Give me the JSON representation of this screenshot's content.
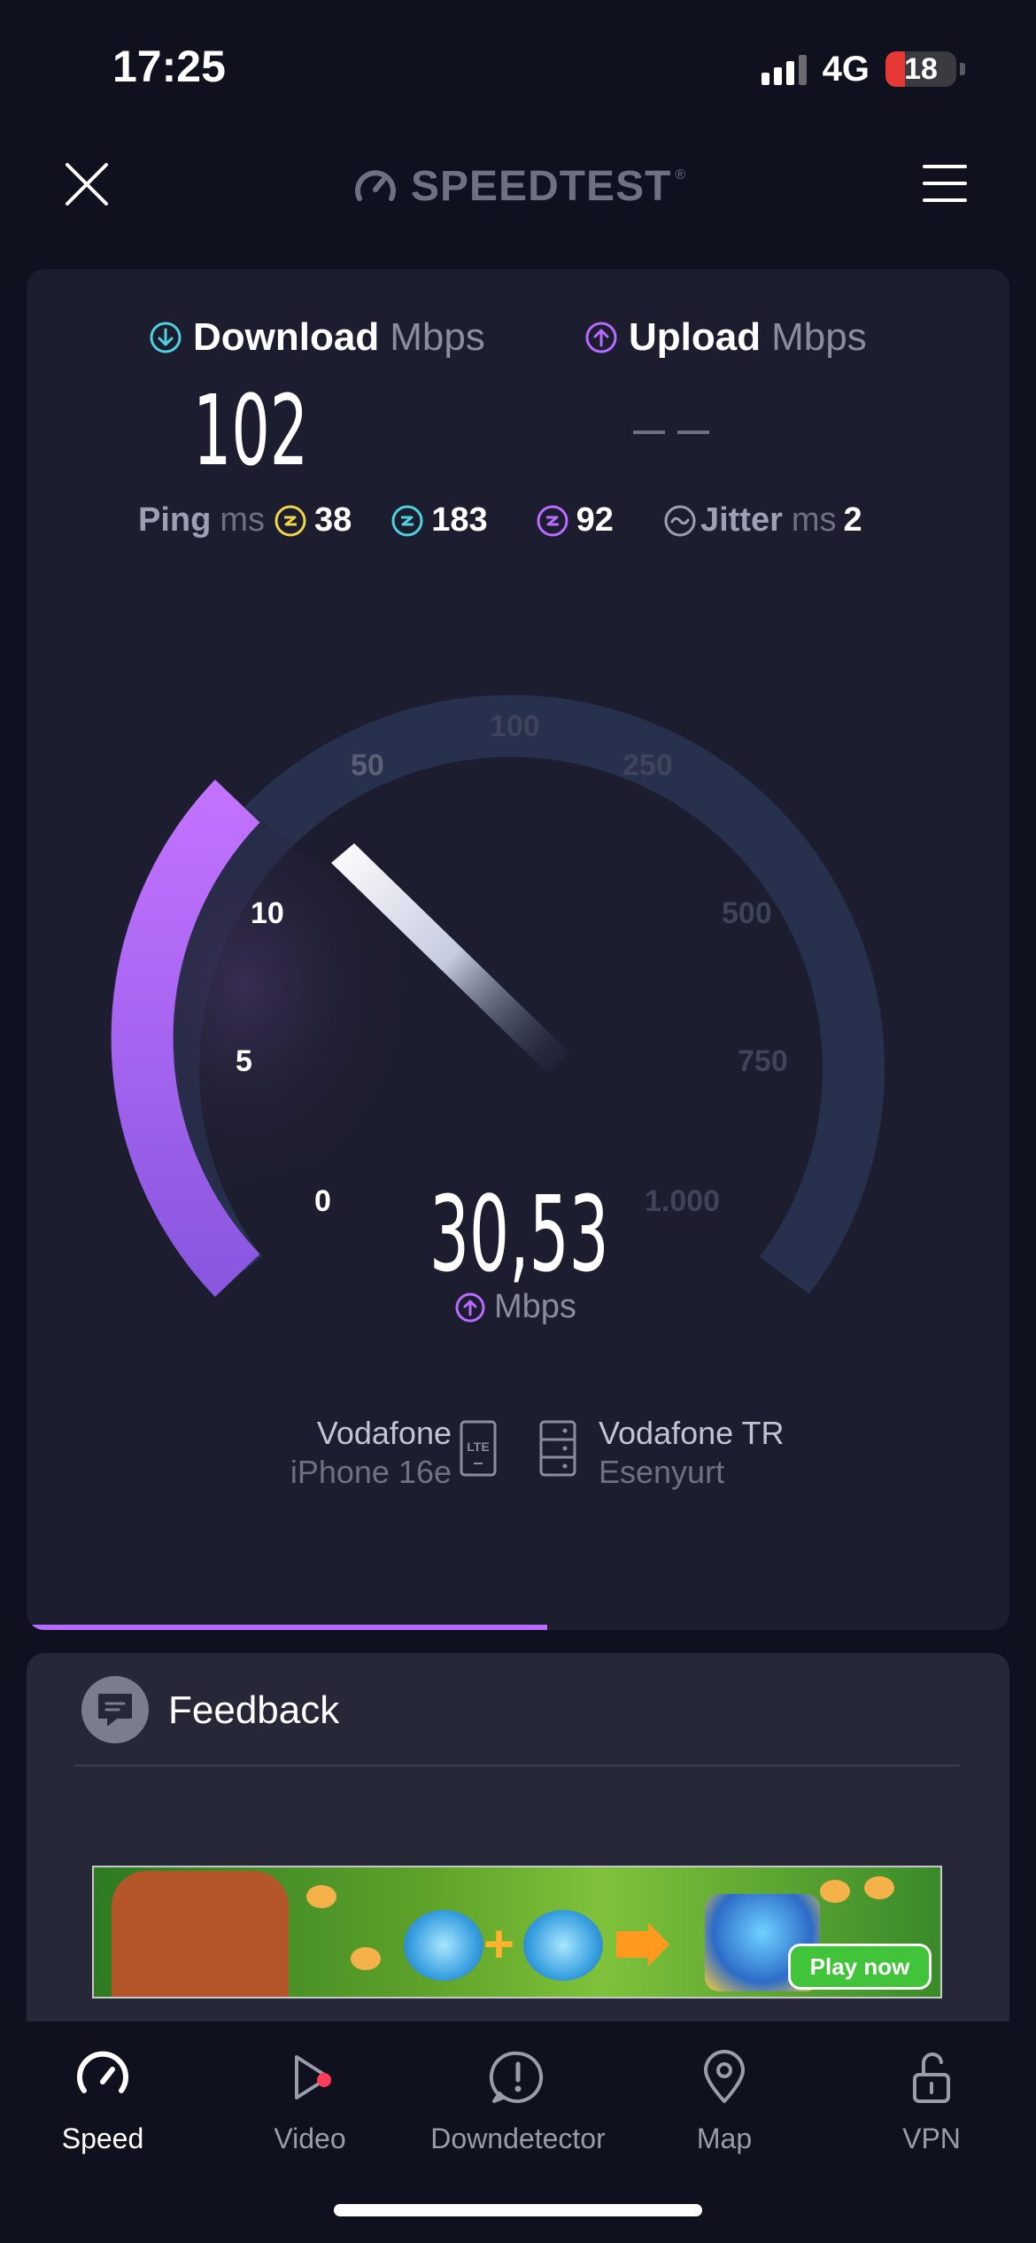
{
  "status_bar": {
    "time": "17:25",
    "network": "4G",
    "battery": "18"
  },
  "header": {
    "brand": "SPEEDTEST",
    "brand_mark": "®"
  },
  "results": {
    "download": {
      "label": "Download",
      "unit": "Mbps",
      "value": "102"
    },
    "upload": {
      "label": "Upload",
      "unit": "Mbps",
      "value": "— —"
    },
    "ping": {
      "label": "Ping",
      "unit": "ms",
      "idle": "38",
      "download": "183",
      "upload": "92"
    },
    "jitter": {
      "label": "Jitter",
      "unit": "ms",
      "value": "2"
    }
  },
  "gauge": {
    "ticks": [
      "0",
      "5",
      "10",
      "50",
      "100",
      "250",
      "500",
      "750",
      "1.000"
    ],
    "current_value": "30,53",
    "current_unit": "Mbps",
    "colors": {
      "active_arc": "#b96bff",
      "inactive_arc": "#27304d"
    }
  },
  "connection": {
    "carrier": "Vodafone",
    "device": "iPhone 16e",
    "connection_type": "LTE",
    "server_provider": "Vodafone TR",
    "server_location": "Esenyurt"
  },
  "test_progress": 0.53,
  "feedback": {
    "label": "Feedback"
  },
  "ad": {
    "cta": "Play now"
  },
  "tabs": [
    {
      "label": "Speed",
      "icon": "speedometer-icon",
      "active": true
    },
    {
      "label": "Video",
      "icon": "play-icon"
    },
    {
      "label": "Downdetector",
      "icon": "alert-icon"
    },
    {
      "label": "Map",
      "icon": "map-pin-icon"
    },
    {
      "label": "VPN",
      "icon": "lock-open-icon"
    }
  ],
  "colors": {
    "download_accent": "#4fd1e0",
    "upload_accent": "#b96bff",
    "ping_idle": "#f0d64a"
  }
}
